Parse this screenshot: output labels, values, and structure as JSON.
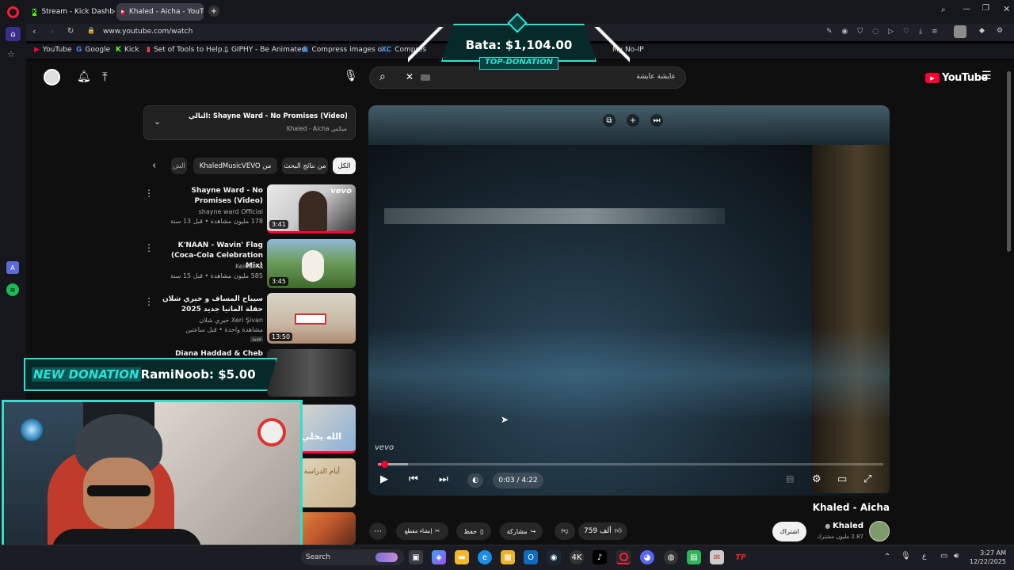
{
  "browser": {
    "tabs": [
      {
        "label": "Stream - Kick Dashboard",
        "active": false
      },
      {
        "label": "Khaled - Aicha - YouTube",
        "active": true
      }
    ],
    "url": "www.youtube.com/watch",
    "bookmarks": [
      {
        "label": "YouTube"
      },
      {
        "label": "Google"
      },
      {
        "label": "Kick"
      },
      {
        "label": "Set of Tools to Help..."
      },
      {
        "label": "GIPHY - Be Animated"
      },
      {
        "label": "Compress images o..."
      },
      {
        "label": "Compres"
      },
      {
        "label": "My No-IP"
      }
    ]
  },
  "overlay": {
    "top_donation_amount": "Bata: $1,104.00",
    "top_donation_label": "TOP-DONATION",
    "new_donation_label": "NEW DONATION",
    "new_donation_text": "RamiNoob: $5.00"
  },
  "youtube": {
    "logo_text": "YouTube",
    "search_value": "عايشة عايشة",
    "queue": {
      "title": "التالي: Shayne Ward - No Promises (Video)",
      "subtitle": "ميكس Khaled - Aicha"
    },
    "chips": [
      {
        "label": "الكل",
        "active": true
      },
      {
        "label": "من نتائج البحث",
        "active": false
      },
      {
        "label": "من KhaledMusicVEVO",
        "active": false
      },
      {
        "label": "الش",
        "active": false
      }
    ],
    "related": [
      {
        "title": "Shayne Ward - No Promises (Video)",
        "channel": "shayne ward Official",
        "meta": "178 مليون مشاهدة • قبل 13 سنة",
        "duration": "3:41",
        "badge": "vevo"
      },
      {
        "title": "K'NAAN - Wavin' Flag (Coca-Cola Celebration Mix)",
        "channel": "Keinan A",
        "meta": "585 مليون مشاهدة • قبل 15 سنة",
        "duration": "3:45",
        "badge": ""
      },
      {
        "title": "سيباح المساف و خيري شلان حفلة المانيا جديد 2025",
        "channel": "خيري شلان Xeri Şivan",
        "meta": "مشاهدة واحدة • قبل ساعتين",
        "duration": "13:50",
        "badge": "جديد"
      },
      {
        "title": "Diana Haddad & Cheb Khalid",
        "channel": "",
        "meta": "",
        "duration": "",
        "badge": ""
      },
      {
        "title": "",
        "channel": "",
        "meta": "",
        "duration": "",
        "badge": "",
        "thumb_text": "الله يخلي"
      },
      {
        "title": "",
        "channel": "",
        "meta": "",
        "duration": "",
        "badge": "",
        "thumb_text": "أيام الدراسة"
      },
      {
        "title": "",
        "channel": "",
        "meta": "",
        "duration": "",
        "badge": ""
      }
    ],
    "player": {
      "time": "0:03 / 4:22",
      "progress_fraction": 0.012,
      "watermark": "vevo"
    },
    "video": {
      "title": "Khaled - Aicha",
      "channel": "Khaled",
      "subscribers": "2.87 مليون مشترك",
      "subscribe_label": "اشتراك",
      "likes": "759 ألف",
      "share_label": "مشاركة",
      "save_label": "حفظ",
      "clip_label": "إنشاء مقطع"
    }
  },
  "taskbar": {
    "search_label": "Search",
    "time": "3:27 AM",
    "date": "12/22/2025",
    "lang": "ع"
  },
  "colors": {
    "accent_red": "#ff0033",
    "overlay_teal": "#2fe0d0",
    "opera_red": "#ff1b2d"
  }
}
